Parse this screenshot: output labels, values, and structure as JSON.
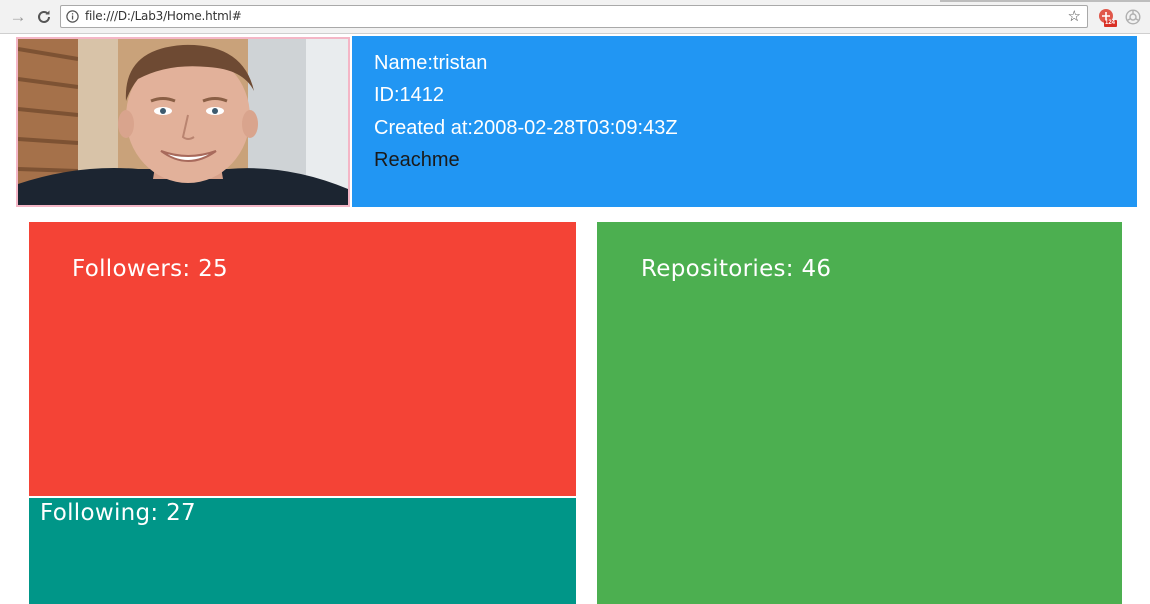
{
  "browser": {
    "url": "file:///D:/Lab3/Home.html#",
    "extension_badge": "124",
    "icons": [
      "back-arrow-icon",
      "reload-icon",
      "info-icon",
      "bookmark-star-icon",
      "extension-icon",
      "extension-icon-2"
    ]
  },
  "profile": {
    "name_line": "Name:tristan",
    "id_line": "ID:1412",
    "created_line": "Created at:2008-02-28T03:09:43Z",
    "reachme_label": "Reachme"
  },
  "stats": {
    "followers_label": "Followers: 25",
    "following_label": "Following: 27",
    "repositories_label": "Repositories: 46"
  },
  "colors": {
    "profile_panel": "#2196f3",
    "followers": "#f44336",
    "following": "#009688",
    "repositories": "#4caf50",
    "avatar_border": "#f4b6c6"
  }
}
